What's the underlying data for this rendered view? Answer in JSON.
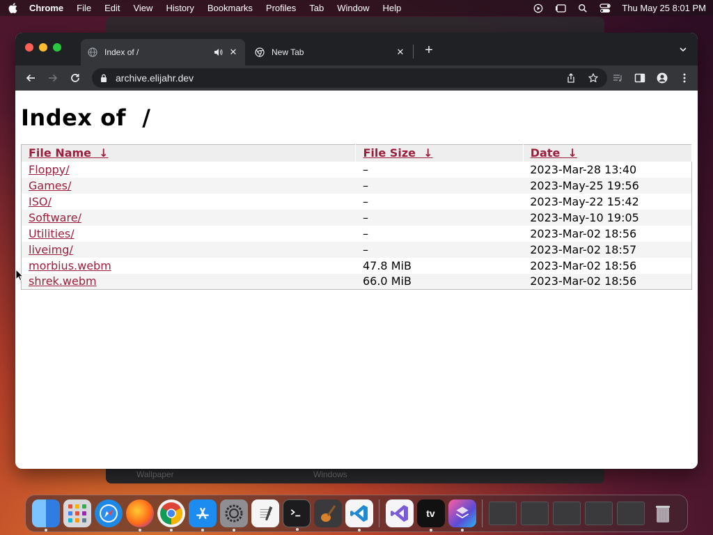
{
  "menubar": {
    "app": "Chrome",
    "items": [
      "File",
      "Edit",
      "View",
      "History",
      "Bookmarks",
      "Profiles",
      "Tab",
      "Window",
      "Help"
    ],
    "clock": "Thu May 25  8:01 PM"
  },
  "background_window": {
    "footer_left": "Wallpaper",
    "footer_right": "Windows"
  },
  "browser": {
    "tabs": [
      {
        "title": "Index of /",
        "active": true,
        "audio": true
      },
      {
        "title": "New Tab",
        "active": false
      }
    ],
    "url": "archive.elijahr.dev"
  },
  "page": {
    "heading": "Index of  /",
    "columns": {
      "name": "File Name  ↓",
      "size": "File Size  ↓",
      "date": "Date  ↓"
    },
    "rows": [
      {
        "name": "Floppy/",
        "size": "–",
        "date": "2023-Mar-28 13:40"
      },
      {
        "name": "Games/",
        "size": "–",
        "date": "2023-May-25 19:56"
      },
      {
        "name": "ISO/",
        "size": "–",
        "date": "2023-May-22 15:42"
      },
      {
        "name": "Software/",
        "size": "–",
        "date": "2023-May-10 19:05"
      },
      {
        "name": "Utilities/",
        "size": "–",
        "date": "2023-Mar-02 18:56"
      },
      {
        "name": "liveimg/",
        "size": "–",
        "date": "2023-Mar-02 18:57"
      },
      {
        "name": "morbius.webm",
        "size": "47.8 MiB",
        "date": "2023-Mar-02 18:56"
      },
      {
        "name": "shrek.webm",
        "size": "66.0 MiB",
        "date": "2023-Mar-02 18:56"
      }
    ],
    "link_color": "#9b1f3c"
  },
  "dock": {
    "apps": [
      {
        "name": "finder",
        "color": "#2f7de1",
        "running": true
      },
      {
        "name": "launchpad",
        "color": "#c8c8cc",
        "running": false
      },
      {
        "name": "safari",
        "color": "#1e88e5",
        "running": false
      },
      {
        "name": "firefox",
        "color": "#e8632b",
        "running": true
      },
      {
        "name": "chrome",
        "color": "#f2f2f2",
        "running": true
      },
      {
        "name": "app-store",
        "color": "#1d8cf0",
        "running": true
      },
      {
        "name": "system-settings",
        "color": "#8e8e93",
        "running": true
      },
      {
        "name": "textedit",
        "color": "#f5f5f5",
        "running": false
      },
      {
        "name": "terminal",
        "color": "#1c1c1e",
        "running": true
      },
      {
        "name": "garageband",
        "color": "#3a3a3c",
        "running": false
      },
      {
        "name": "vscode",
        "color": "#1f8ad2",
        "running": true
      },
      {
        "name": "visual-studio",
        "color": "#f5f5f7",
        "running": false
      },
      {
        "name": "apple-tv",
        "color": "#111111",
        "running": true,
        "label": "tv"
      },
      {
        "name": "shortcuts",
        "color": "#5b4bd6",
        "running": true
      }
    ]
  }
}
